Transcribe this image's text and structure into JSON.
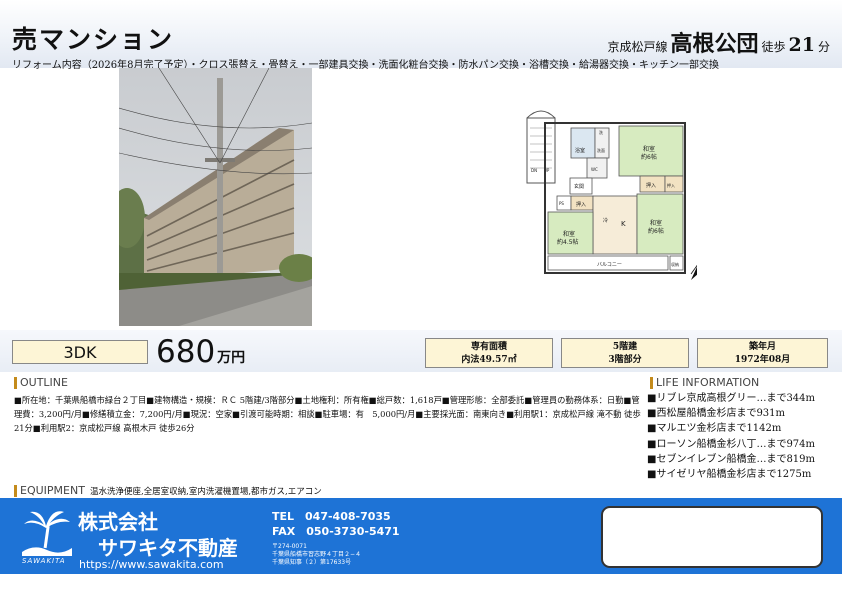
{
  "header": {
    "title": "売マンション",
    "station_line": "京成松戸線",
    "station_name": "高根公団",
    "walk_label": "徒歩",
    "walk_minutes": "21",
    "walk_unit": "分",
    "reform": "リフォーム内容（2026年8月完了予定）・クロス張替え・畳替え・一部建具交換・洗面化粧台交換・防水パン交換・浴槽交換・給湯器交換・キッチン一部交換"
  },
  "floorplan": {
    "rooms": [
      {
        "label": "和室",
        "sub": "約6帖"
      },
      {
        "label": "和室",
        "sub": "約6帖"
      },
      {
        "label": "和室",
        "sub": "約4.5帖"
      }
    ],
    "labels": {
      "bath": "浴室",
      "washroom": "洗面",
      "toilet": "WC",
      "entrance": "玄関",
      "kitchen": "K",
      "fridge": "冷",
      "closet": "押入",
      "ps": "PS",
      "mb": "MB",
      "balcony": "バルコニー",
      "dn": "DN",
      "up": "UP",
      "laundry": "洗",
      "storage": "収納"
    }
  },
  "summary": {
    "layout": "3DK",
    "price": "680",
    "price_unit": "万円",
    "area_label": "専有面積",
    "area_value": "内法49.57㎡",
    "floors_label": "5階建",
    "floors_value": "3階部分",
    "built_label": "築年月",
    "built_value": "1972年08月"
  },
  "outline": {
    "heading": "OUTLINE",
    "text": "■所在地：千葉県船橋市緑台２丁目■建物構造・規模：ＲＣ 5階建/3階部分■土地権利：所有権■総戸数：1,618戸■管理形態：全部委託■管理員の勤務体系：日勤■管理費：3,200円/月■修繕積立金：7,200円/月■現況：空家■引渡可能時期：相談■駐車場：有　5,000円/月■主要採光面：南東向き■利用駅1：京成松戸線 滝不動 徒歩21分■利用駅2：京成松戸線 高根木戸 徒歩26分"
  },
  "life": {
    "heading": "LIFE INFORMATION",
    "items": [
      "■リブレ京成高根グリー…まで344m",
      "■西松屋船橋金杉店まで931m",
      "■マルエツ金杉店まで1142m",
      "■ローソン船橋金杉八丁…まで974m",
      "■セブンイレブン船橋金…まで819m",
      "■サイゼリヤ船橋金杉店まで1275m"
    ]
  },
  "equipment": {
    "heading": "EQUIPMENT",
    "text": "温水洗浄便座,全居室収納,室内洗濯機置場,都市ガス,エアコン"
  },
  "company": {
    "logo_word": "SAWAKITA",
    "name_1": "株式会社",
    "name_2": "サワキタ不動産",
    "url": "https://www.sawakita.com",
    "tel": "TEL　047-408-7035",
    "fax": "FAX　050-3730-5471",
    "postal": "〒274-0071",
    "address": "千葉県船橋市習志野４丁目２−４",
    "license": "千葉県知事（２）第17633号"
  }
}
